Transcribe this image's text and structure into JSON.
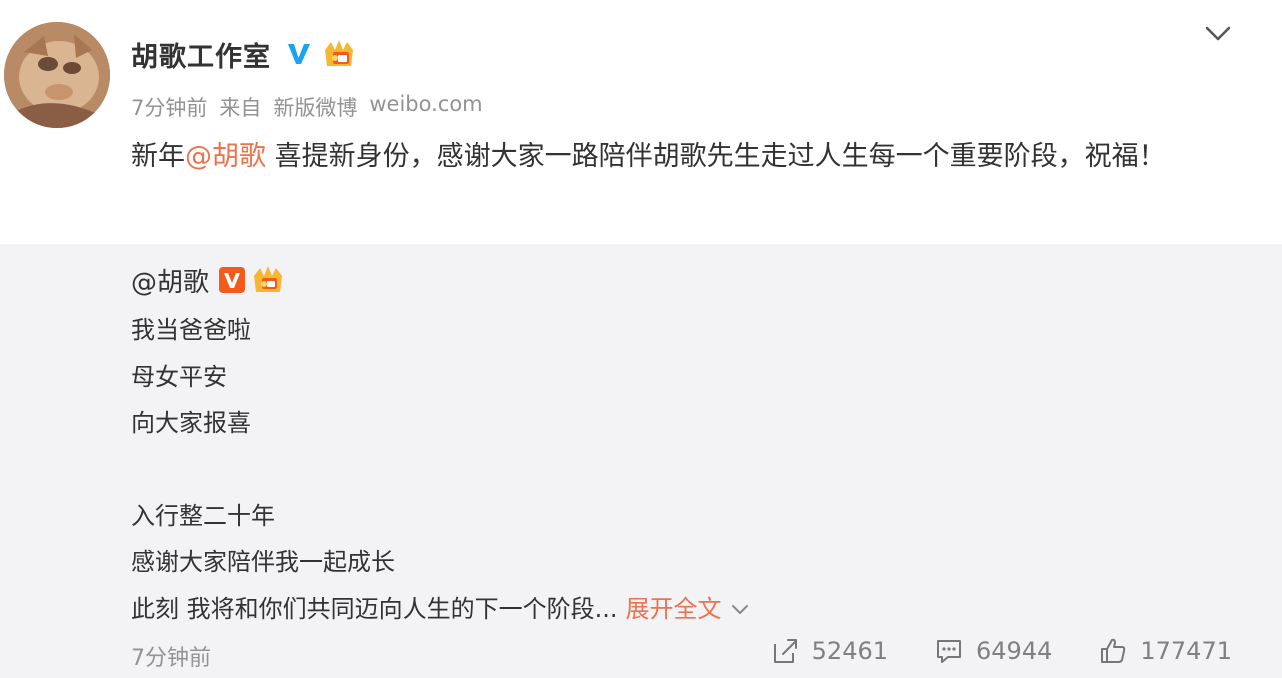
{
  "author": {
    "name": "胡歌工作室"
  },
  "meta": {
    "time": "7分钟前",
    "source_prefix": "来自",
    "source_name": "新版微博",
    "source_domain": "weibo.com"
  },
  "post": {
    "text_before": "新年",
    "mention": "@胡歌",
    "text_after": " 喜提新身份，感谢大家一路陪伴胡歌先生走过人生每一个重要阶段，祝福！"
  },
  "repost": {
    "author": "@胡歌",
    "lines": [
      "我当爸爸啦",
      "母女平安",
      "向大家报喜",
      "",
      "入行整二十年",
      "感谢大家陪伴我一起成长",
      "此刻 我将和你们共同迈向人生的下一个阶段..."
    ],
    "expand_label": "展开全文",
    "time": "7分钟前",
    "reposts": "52461",
    "comments": "64944",
    "likes": "177471"
  },
  "icons": {
    "verified": "verified-v-icon",
    "crown": "crown-badge-icon",
    "menu": "chevron-down-icon",
    "repost": "repost-icon",
    "comment": "comment-icon",
    "like": "thumbs-up-icon"
  },
  "colors": {
    "accent": "#eb7350",
    "verified_blue": "#1da1f2",
    "verified_orange": "#f35a1c",
    "muted": "#939393",
    "repost_bg": "#f3f3f5"
  }
}
